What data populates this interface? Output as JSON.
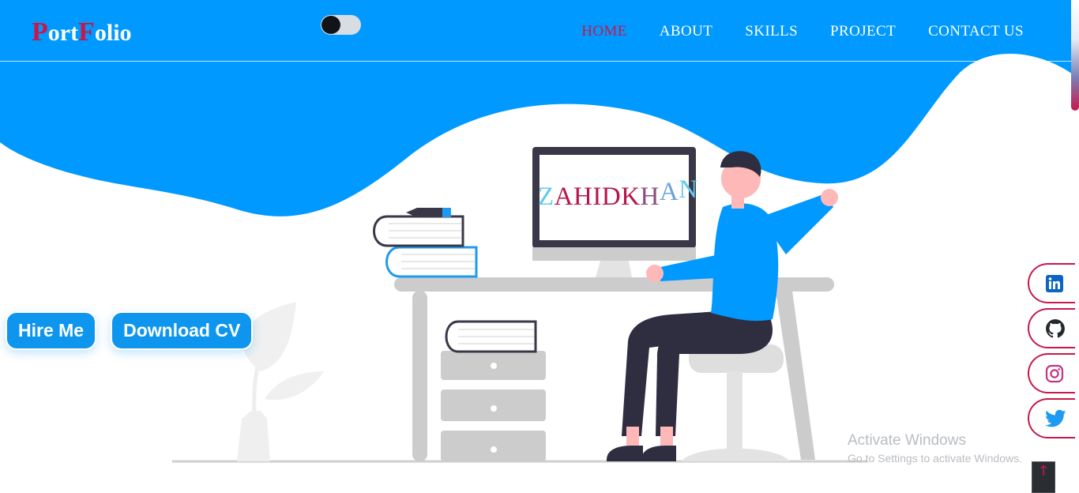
{
  "brand": {
    "logo_p": "P",
    "logo_ort": "ort",
    "logo_f": "F",
    "logo_olio": "olio"
  },
  "nav": {
    "items": [
      {
        "label": "HOME",
        "active": true
      },
      {
        "label": "ABOUT"
      },
      {
        "label": "SKILLS"
      },
      {
        "label": "PROJECT"
      },
      {
        "label": "CONTACT US"
      }
    ]
  },
  "hero": {
    "screen_letters": [
      "Z",
      "A",
      "H",
      "I",
      "D",
      "K",
      "H",
      "A",
      "N"
    ],
    "hire_label": "Hire Me",
    "cv_label": "Download CV"
  },
  "socials": [
    {
      "icon": "linkedin-icon"
    },
    {
      "icon": "github-icon"
    },
    {
      "icon": "instagram-icon"
    },
    {
      "icon": "twitter-icon"
    }
  ],
  "watermark": {
    "title": "Activate Windows",
    "subtitle": "Go to Settings to activate Windows."
  },
  "back_to_top": "↑",
  "colors": {
    "primary": "#0099ff",
    "accent": "#c8174a",
    "button": "#0e96ee"
  }
}
